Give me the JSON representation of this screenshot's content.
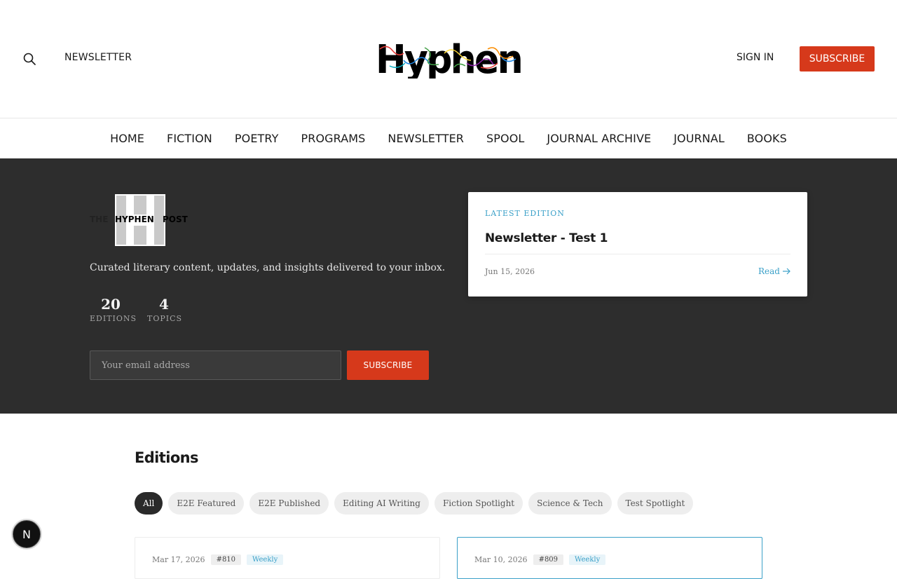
{
  "header": {
    "newsletter_link": "NEWSLETTER",
    "logo_text": "Hyphen",
    "sign_in": "SIGN IN",
    "subscribe": "SUBSCRIBE"
  },
  "nav": {
    "items": [
      "HOME",
      "FICTION",
      "POETRY",
      "PROGRAMS",
      "NEWSLETTER",
      "SPOOL",
      "JOURNAL ARCHIVE",
      "JOURNAL",
      "BOOKS"
    ]
  },
  "hero": {
    "post_logo": {
      "left": "THE",
      "middle": "HYPHEN",
      "right": "POST"
    },
    "tagline": "Curated literary content, updates, and insights delivered to your inbox.",
    "stats": [
      {
        "value": "20",
        "label": "EDITIONS"
      },
      {
        "value": "4",
        "label": "TOPICS"
      }
    ],
    "email_placeholder": "Your email address",
    "subscribe": "SUBSCRIBE",
    "latest": {
      "label": "LATEST EDITION",
      "title": "Newsletter - Test 1",
      "date": "Jun 15, 2026",
      "read": "Read"
    }
  },
  "editions": {
    "title": "Editions",
    "filters": [
      "All",
      "E2E Featured",
      "E2E Published",
      "Editing AI Writing",
      "Fiction Spotlight",
      "Science & Tech",
      "Test Spotlight"
    ],
    "cards": [
      {
        "date": "Mar 17, 2026",
        "number": "#810",
        "tag": "Weekly"
      },
      {
        "date": "Mar 10, 2026",
        "number": "#809",
        "tag": "Weekly"
      }
    ]
  },
  "badge": {
    "letter": "N"
  },
  "colors": {
    "accent": "#d6391b",
    "link": "#3aa0c8",
    "hero_bg": "#2d2d2d"
  }
}
